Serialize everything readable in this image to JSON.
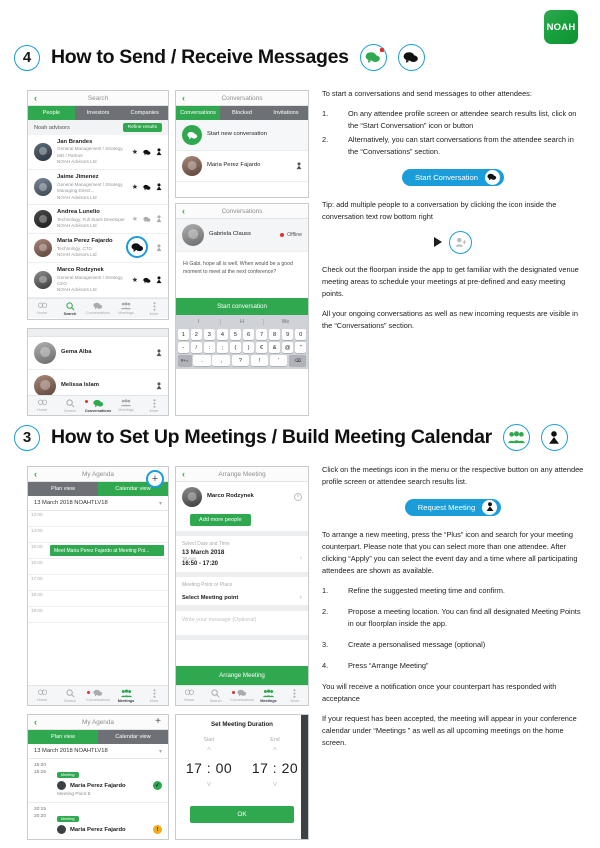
{
  "brand": {
    "logo_text": "NOAH",
    "accent_blue": "#1b9dd9",
    "accent_green": "#2fa84f"
  },
  "sections": [
    {
      "number": "4",
      "title": "How to Send / Receive Messages",
      "icons": [
        "conversations-icon",
        "chat-bubble-icon"
      ],
      "intro": "To start a conversations and send messages to other attendees:",
      "steps": [
        {
          "n": "1.",
          "text": "On any attendee profile screen or attendee search results list, click on the “Start Conversation” icon or button"
        },
        {
          "n": "2.",
          "text": "Alternatively, you can start conversations from the attendee search in the “Conversations” section."
        }
      ],
      "button_label": "Start Conversation",
      "tip": "Tip: add multiple people to a conversation by clicking the icon inside the conversation text row bottom right",
      "paragraphs": [
        "Check out the floorpan inside the app to get familiar with the designated venue meeting areas to schedule your meetings at pre-defined and easy meeting points.",
        "All your ongoing conversations as well as new incoming requests are visible in the “Conversations” section."
      ]
    },
    {
      "number": "3",
      "title": "How to Set Up Meetings / Build Meeting Calendar",
      "icons": [
        "meetings-group-icon",
        "request-meeting-icon"
      ],
      "intro": "Click on the meetings icon in the menu or the respective button on any attendee profile screen or attendee search results list.",
      "button_label": "Request Meeting",
      "para_before_list": "To arrange a new meeting, press the “Plus” icon and search for your meeting counterpart. Please note that you can select more than one attendee. After clicking “Apply” you can select the event day and a time where all participating attendees are shown as available.",
      "steps": [
        {
          "n": "1.",
          "text": "Refine the suggested meeting time and confirm."
        },
        {
          "n": "2.",
          "text": "Propose a meeting location. You can find all designated Meeting Points in our floorplan inside the app."
        },
        {
          "n": "3.",
          "text": "Create a personalised message (optional)"
        },
        {
          "n": "4.",
          "text": "Press “Arrange Meeting”"
        }
      ],
      "paragraphs": [
        "You will receive a notification once your counterpart has responded with acceptance",
        "If your request has been accepted, the meeting will appear in your conference calendar under “Meetings ” as well as all upcoming meetings on the home screen."
      ]
    }
  ],
  "search_screen": {
    "title": "Search",
    "back": "‹",
    "tabs": [
      {
        "label": "People",
        "active": true
      },
      {
        "label": "Investors",
        "active": false
      },
      {
        "label": "Companies",
        "active": false
      }
    ],
    "group_label": "Noah advisors",
    "refine_label": "Refine results",
    "people": [
      {
        "name": "Jan Brandes",
        "role": "General Management / Strategy, MD / Partner",
        "company": "NOAH Advisors Ltd",
        "muted": false
      },
      {
        "name": "Jaime Jimenez",
        "role": "General Management / Strategy, Managing Direct...",
        "company": "NOAH Advisors Ltd",
        "muted": false
      },
      {
        "name": "Andrea Lunelio",
        "role": "Technology, Full Stack Developer",
        "company": "NOAH Advisors Ltd",
        "muted": true
      },
      {
        "name": "Maria Perez Fajardo",
        "role": "Technology, CTO",
        "company": "NOAH Advisors Ltd",
        "muted": false,
        "highlight": true
      },
      {
        "name": "Marco Rodzynek",
        "role": "General Management / Strategy, CEO",
        "company": "NOAH Advisors Ltd",
        "muted": false
      }
    ],
    "tabbar": [
      {
        "label": "Home",
        "icon": "home-icon",
        "active": false
      },
      {
        "label": "Search",
        "icon": "search-icon",
        "active": true
      },
      {
        "label": "Conversations",
        "icon": "conversations-icon",
        "active": false
      },
      {
        "label": "Meetings",
        "icon": "meetings-icon",
        "active": false
      },
      {
        "label": "More",
        "icon": "more-icon",
        "active": false
      }
    ]
  },
  "search_results_bottom": {
    "rows": [
      {
        "name": "Gema Alba"
      },
      {
        "name": "Melissa Islam"
      }
    ],
    "tabbar": [
      {
        "label": "Home",
        "icon": "home-icon",
        "active": false
      },
      {
        "label": "Search",
        "icon": "search-icon",
        "active": false
      },
      {
        "label": "Conversations",
        "icon": "conversations-icon",
        "active": true
      },
      {
        "label": "Meetings",
        "icon": "meetings-icon",
        "active": false
      },
      {
        "label": "More",
        "icon": "more-icon",
        "active": false
      }
    ]
  },
  "conversations_screen": {
    "title": "Conversations",
    "tabs": [
      {
        "label": "Conversations",
        "active": true
      },
      {
        "label": "Blocked",
        "active": false
      },
      {
        "label": "Invitations",
        "active": false
      }
    ],
    "start_new_label": "Start new conversation",
    "rows": [
      {
        "name": "Maria Perez Fajardo"
      }
    ]
  },
  "conversation_detail": {
    "title": "Conversations",
    "contact": "Gabriela Clauss",
    "status": "Offline",
    "message": "Hi Gabi, hope all is well. When would be a good moment to meet at the next conference?",
    "start_button": "Start conversation",
    "keyboard": {
      "suggestions": [
        "I",
        "H",
        "We"
      ],
      "numbers": [
        "1",
        "2",
        "3",
        "4",
        "5",
        "6",
        "7",
        "8",
        "9",
        "0"
      ],
      "symbols": [
        "-",
        "/",
        ":",
        ";",
        "(",
        ")",
        "€",
        "&",
        "@",
        "\""
      ],
      "bottom": [
        "#+=",
        ".",
        ",",
        "?",
        "!",
        "'",
        "⌫"
      ]
    }
  },
  "agenda_calendar": {
    "title": "My Agenda",
    "plus": "+",
    "tabs": [
      {
        "label": "Plan view",
        "active": false
      },
      {
        "label": "Calendar view",
        "active": true
      }
    ],
    "day": "13 March 2018 NOAHTLV18",
    "slots": [
      "13:00",
      "14:00",
      "15:00",
      "16:00",
      "17:00",
      "18:00",
      "19:00"
    ],
    "event": {
      "label": "Meet Maria Perez Fajardo at Meeting Poi...",
      "slot": "15:00"
    },
    "tabbar": [
      {
        "label": "Home",
        "icon": "home-icon",
        "active": false
      },
      {
        "label": "Search",
        "icon": "search-icon",
        "active": false
      },
      {
        "label": "Conversations",
        "icon": "conversations-icon",
        "active": false
      },
      {
        "label": "Meetings",
        "icon": "meetings-icon",
        "active": true
      },
      {
        "label": "More",
        "icon": "more-icon",
        "active": false
      }
    ]
  },
  "arrange_meeting": {
    "title": "Arrange Meeting",
    "attendee": "Marco Rodzynek",
    "add_people_label": "Add more people",
    "date_label": "Select Date and Time",
    "date_value": "13 March 2018",
    "time_sub": "Tel Aviv",
    "time_value": "16:50 - 17:20",
    "point_label": "Meeting Point or Place",
    "point_value": "Select Meeting point",
    "message_placeholder": "Write your message (Optional)",
    "submit_label": "Arrange Meeting",
    "tabbar": [
      {
        "label": "Home",
        "icon": "home-icon",
        "active": false
      },
      {
        "label": "Search",
        "icon": "search-icon",
        "active": false
      },
      {
        "label": "Conversations",
        "icon": "conversations-icon",
        "active": false
      },
      {
        "label": "Meetings",
        "icon": "meetings-icon",
        "active": true
      },
      {
        "label": "More",
        "icon": "more-icon",
        "active": false
      }
    ]
  },
  "agenda_plan": {
    "title": "My Agenda",
    "plus": "+",
    "tabs": [
      {
        "label": "Plan view",
        "active": true
      },
      {
        "label": "Calendar view",
        "active": false
      }
    ],
    "day": "13 March 2018 NOAHTLV18",
    "rows": [
      {
        "start": "15:20",
        "end": "15:25",
        "badge": "Meeting",
        "name": "Maria Perez Fajardo",
        "location": "Meeting Point E",
        "status": "accepted"
      },
      {
        "start": "20:15",
        "end": "20:20",
        "badge": "Meeting",
        "name": "Maria Perez Fajardo",
        "location": "",
        "status": "pending"
      }
    ]
  },
  "duration_modal": {
    "title": "Set Meeting Duration",
    "start_label": "Start",
    "end_label": "End",
    "start_value": "17 : 00",
    "end_value": "17 : 20",
    "ok_label": "OK"
  }
}
